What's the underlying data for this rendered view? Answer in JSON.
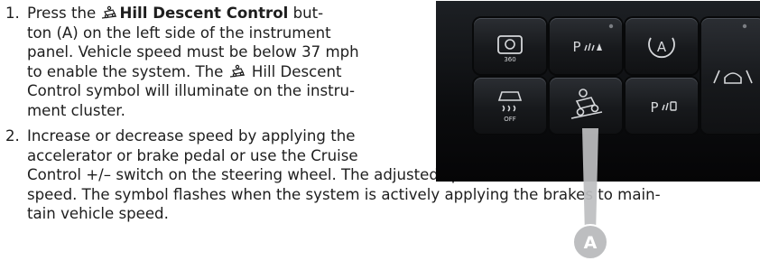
{
  "instructions": {
    "step1": {
      "number": "1.",
      "line1_pre": "Press the ",
      "line1_bold": "Hill Descent Control",
      "line1_post": " but-",
      "line2": "ton (A) on the left side of the instrument",
      "line3": "panel. Vehicle speed must be below 37 mph",
      "line4_pre": "to enable the system. The ",
      "line4_post": " Hill Descent",
      "line5": "Control symbol will illuminate on the instru-",
      "line6": "ment cluster."
    },
    "step2": {
      "number": "2.",
      "line1": "Increase or decrease speed by applying the",
      "line2": "accelerator or brake pedal or use the Cruise",
      "line3": "Control +/– switch on the steering wheel. The adjusted speed becomes the new set",
      "line4": "speed. The symbol flashes when the system is actively applying the brakes to main-",
      "line5": "tain vehicle speed."
    }
  },
  "photo": {
    "buttons": [
      {
        "name": "360-camera-button",
        "label": "360"
      },
      {
        "name": "park-sense-front-button",
        "label": "P"
      },
      {
        "name": "auto-stop-start-button",
        "label": "A"
      },
      {
        "name": "traction-control-off-button",
        "label": "OFF"
      },
      {
        "name": "hill-descent-control-button",
        "label": ""
      },
      {
        "name": "park-sense-rear-button",
        "label": "P"
      }
    ],
    "callout_label": "A"
  }
}
